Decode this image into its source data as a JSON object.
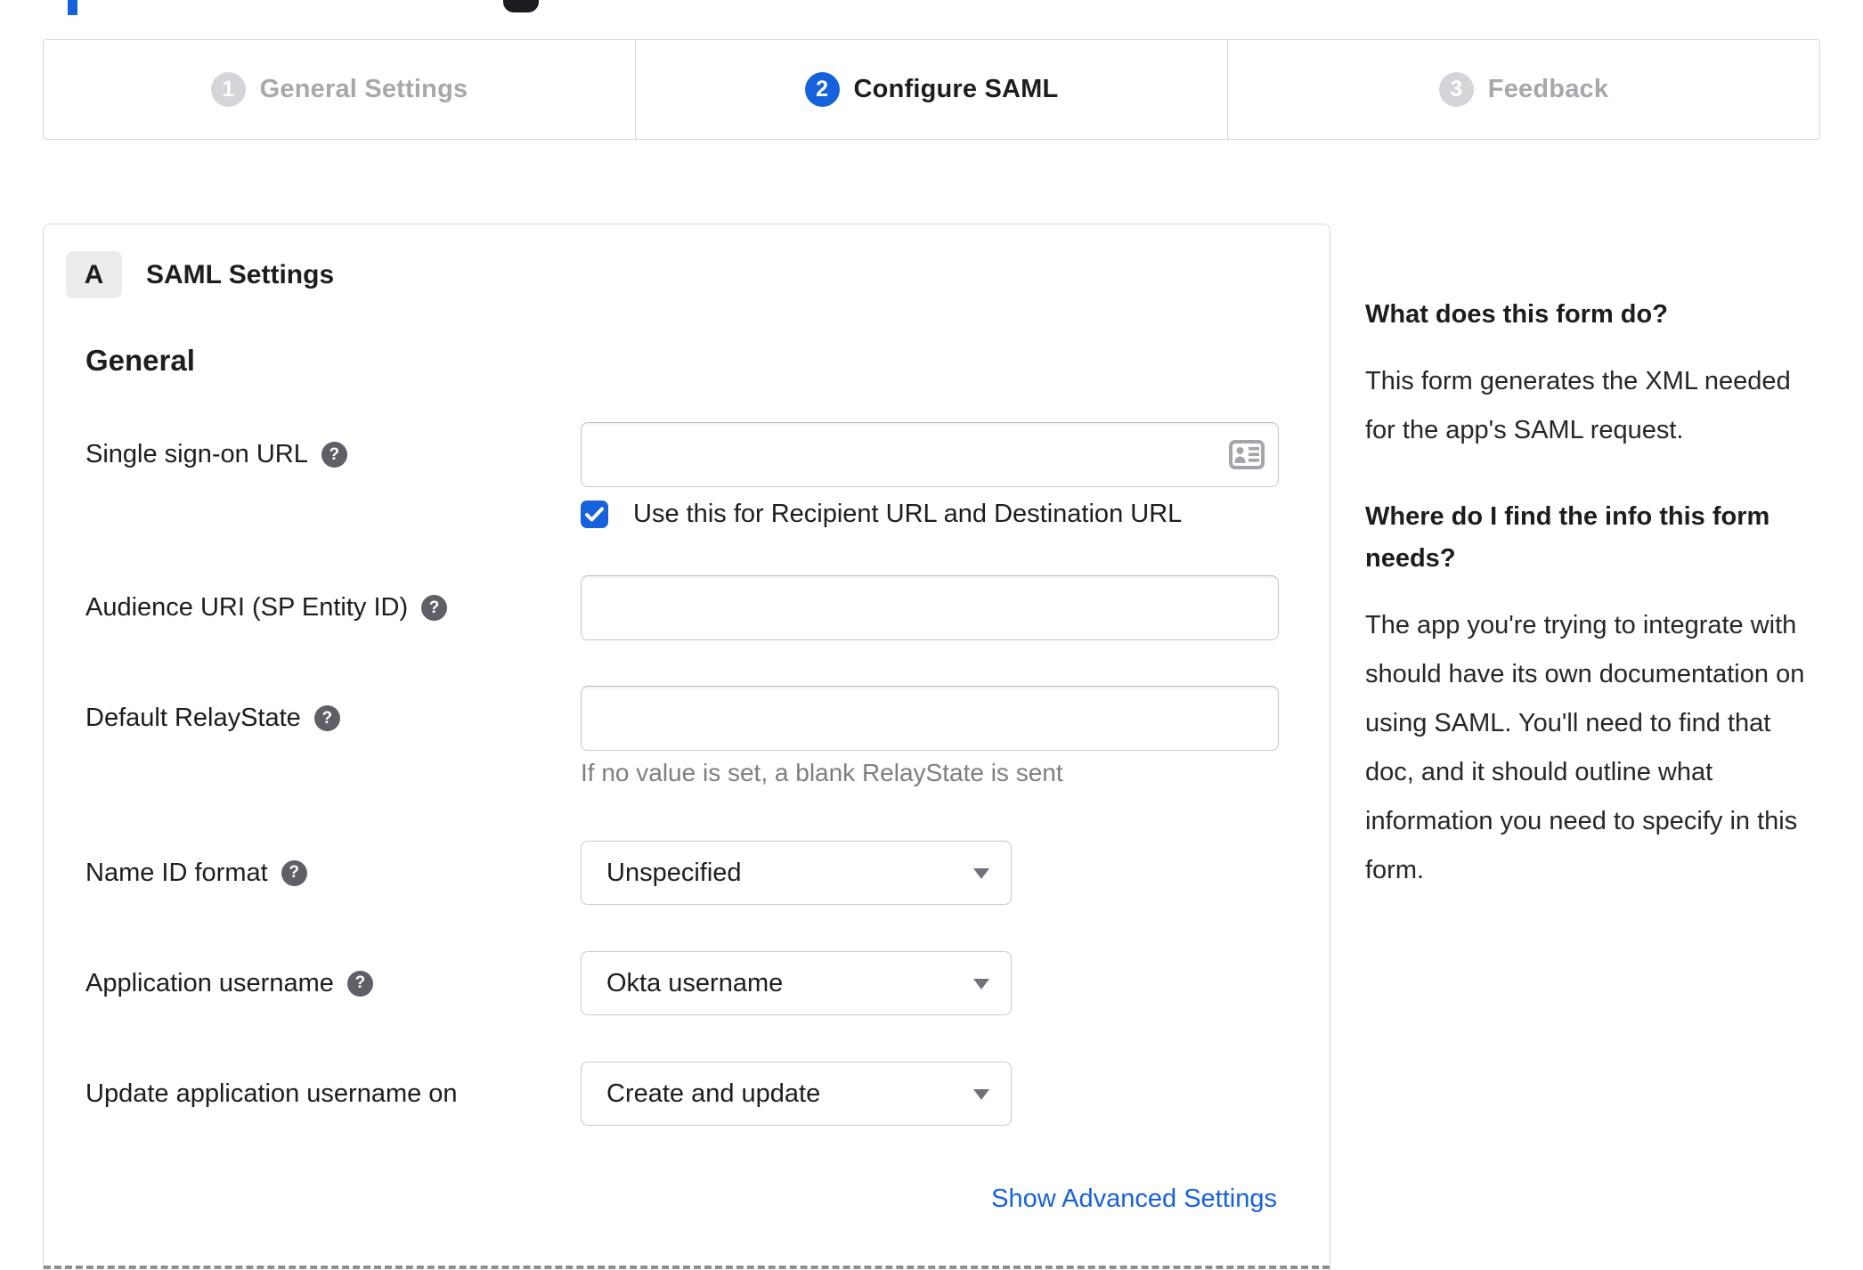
{
  "colors": {
    "accent_blue": "#1662dd",
    "text": "#1d1d21",
    "inactive_gray": "#a7a7ad",
    "border": "#d8d8dc"
  },
  "icons": {
    "help_glyph": "?",
    "check": "checkmark",
    "address_card": "address-card",
    "caret": "caret-down"
  },
  "stepper": {
    "steps": [
      {
        "number": "1",
        "label": "General Settings",
        "state": "inactive"
      },
      {
        "number": "2",
        "label": "Configure SAML",
        "state": "active"
      },
      {
        "number": "3",
        "label": "Feedback",
        "state": "inactive"
      }
    ]
  },
  "panel": {
    "section_badge": "A",
    "section_title": "SAML Settings",
    "group_heading": "General"
  },
  "form": {
    "sso": {
      "label": "Single sign-on URL",
      "value": "",
      "checkbox_label": "Use this for Recipient URL and Destination URL",
      "checkbox_checked": true
    },
    "audience": {
      "label": "Audience URI (SP Entity ID)",
      "value": ""
    },
    "relay_state": {
      "label": "Default RelayState",
      "value": "",
      "helper": "If no value is set, a blank RelayState is sent"
    },
    "name_id": {
      "label": "Name ID format",
      "value": "Unspecified"
    },
    "app_username": {
      "label": "Application username",
      "value": "Okta username"
    },
    "update_username": {
      "label": "Update application username on",
      "value": "Create and update"
    },
    "advanced_link": "Show Advanced Settings"
  },
  "sidebar": {
    "q1": "What does this form do?",
    "a1": "This form generates the XML needed for the app's SAML request.",
    "q2": "Where do I find the info this form needs?",
    "a2": "The app you're trying to integrate with should have its own documentation on using SAML. You'll need to find that doc, and it should outline what information you need to specify in this form."
  }
}
